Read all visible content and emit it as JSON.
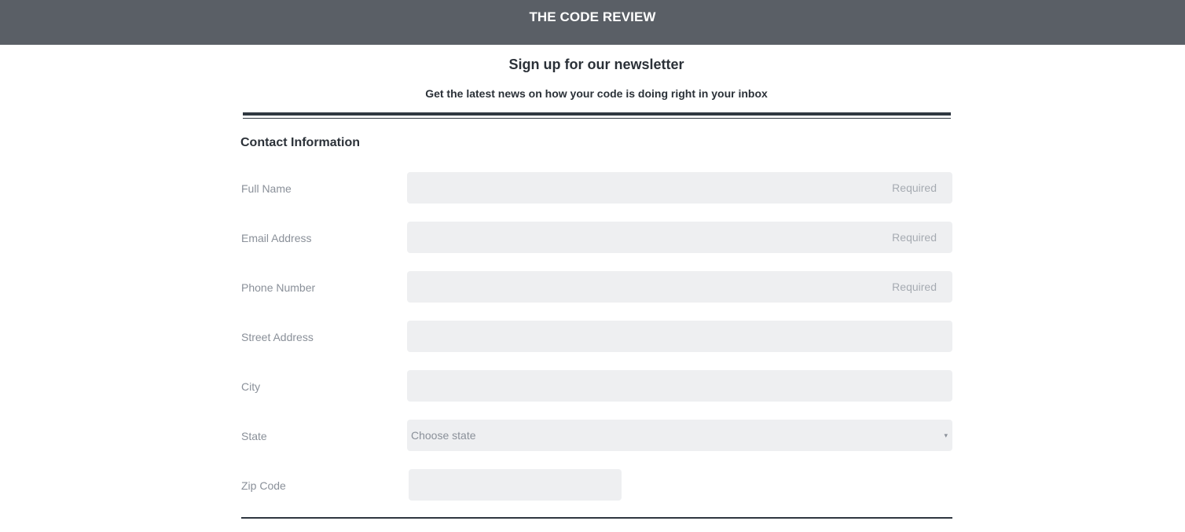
{
  "header": {
    "brand": "THE CODE REVIEW"
  },
  "hero": {
    "title": "Sign up for our newsletter",
    "subtitle": "Get the latest news on how your code is doing right in your inbox"
  },
  "form": {
    "section_title": "Contact Information",
    "fields": [
      {
        "label": "Full Name",
        "placeholder": "Required"
      },
      {
        "label": "Email Address",
        "placeholder": "Required"
      },
      {
        "label": "Phone Number",
        "placeholder": "Required"
      },
      {
        "label": "Street Address",
        "placeholder": ""
      },
      {
        "label": "City",
        "placeholder": ""
      }
    ],
    "state": {
      "label": "State",
      "selected": "Choose state",
      "caret_icon": "▾"
    },
    "zip": {
      "label": "Zip Code",
      "placeholder": ""
    }
  },
  "colors": {
    "header_bg": "#5a5f66",
    "field_bg": "#eeeff1",
    "text_dark": "#2b3138",
    "label_gray": "#8a9099"
  }
}
